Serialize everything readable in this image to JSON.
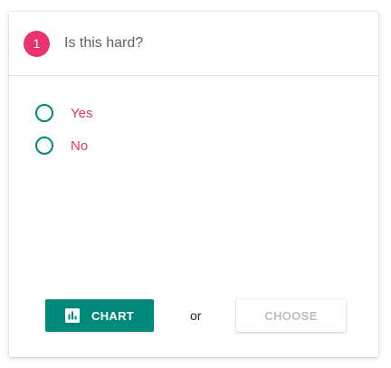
{
  "colors": {
    "accent_pink": "#e8336e",
    "accent_teal": "#00897b",
    "disabled_text": "#bdbdbd"
  },
  "header": {
    "step_number": "1",
    "question": "Is this hard?"
  },
  "options": [
    {
      "label": "Yes",
      "selected": false
    },
    {
      "label": "No",
      "selected": false
    }
  ],
  "actions": {
    "chart_label": "CHART",
    "chart_icon": "bar-chart-icon",
    "separator": "or",
    "choose_label": "CHOOSE",
    "choose_disabled": true
  }
}
